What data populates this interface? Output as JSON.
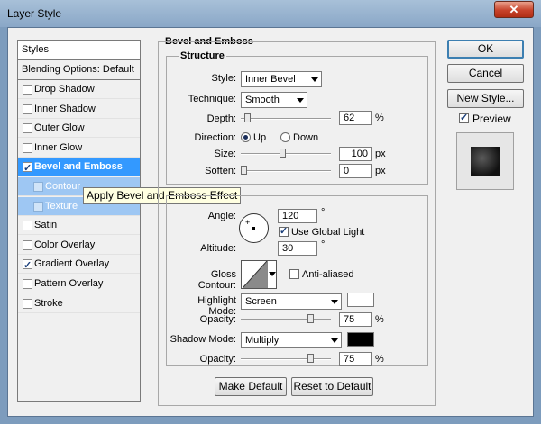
{
  "window": {
    "title": "Layer Style",
    "close_glyph": "✕"
  },
  "styles_list": {
    "header": "Styles",
    "blending": "Blending Options: Default",
    "items": [
      {
        "label": "Drop Shadow",
        "checked": false
      },
      {
        "label": "Inner Shadow",
        "checked": false
      },
      {
        "label": "Outer Glow",
        "checked": false
      },
      {
        "label": "Inner Glow",
        "checked": false
      },
      {
        "label": "Bevel and Emboss",
        "checked": true,
        "selected": true
      },
      {
        "label": "Contour",
        "checked": false,
        "sub": true
      },
      {
        "label": "Texture",
        "checked": false,
        "sub": true
      },
      {
        "label": "Satin",
        "checked": false
      },
      {
        "label": "Color Overlay",
        "checked": false
      },
      {
        "label": "Gradient Overlay",
        "checked": true
      },
      {
        "label": "Pattern Overlay",
        "checked": false
      },
      {
        "label": "Stroke",
        "checked": false
      }
    ]
  },
  "tooltip": "Apply Bevel and Emboss Effect",
  "bevel": {
    "title": "Bevel and Emboss",
    "structure": {
      "title": "Structure",
      "style_label": "Style:",
      "style_value": "Inner Bevel",
      "technique_label": "Technique:",
      "technique_value": "Smooth",
      "depth_label": "Depth:",
      "depth_value": "62",
      "depth_unit": "%",
      "direction_label": "Direction:",
      "dir_up": "Up",
      "dir_down": "Down",
      "size_label": "Size:",
      "size_value": "100",
      "size_unit": "px",
      "soften_label": "Soften:",
      "soften_value": "0",
      "soften_unit": "px"
    },
    "shading": {
      "angle_label": "Angle:",
      "angle_value": "120",
      "angle_unit": "°",
      "global_light_label": "Use Global Light",
      "altitude_label": "Altitude:",
      "altitude_value": "30",
      "altitude_unit": "°",
      "gloss_label": "Gloss Contour:",
      "antialiased_label": "Anti-aliased",
      "highlight_label": "Highlight Mode:",
      "highlight_value": "Screen",
      "highlight_color": "#ffffff",
      "hl_opacity_label": "Opacity:",
      "hl_opacity_value": "75",
      "hl_opacity_unit": "%",
      "shadow_label": "Shadow Mode:",
      "shadow_value": "Multiply",
      "shadow_color": "#000000",
      "sh_opacity_label": "Opacity:",
      "sh_opacity_value": "75",
      "sh_opacity_unit": "%"
    },
    "make_default": "Make Default",
    "reset_default": "Reset to Default"
  },
  "buttons": {
    "ok": "OK",
    "cancel": "Cancel",
    "new_style": "New Style...",
    "preview": "Preview"
  }
}
